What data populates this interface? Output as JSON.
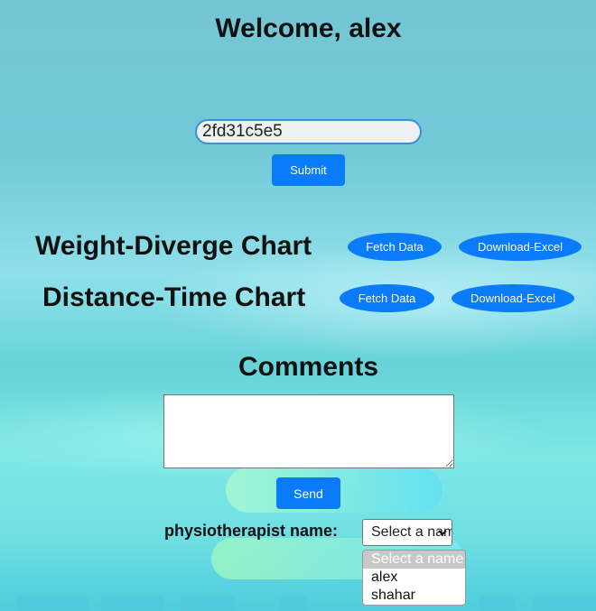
{
  "header": {
    "welcome": "Welcome, alex"
  },
  "code_form": {
    "input_value": "2fd31c5e5",
    "submit_label": "Submit"
  },
  "charts": [
    {
      "title": "Weight-Diverge Chart",
      "fetch_label": "Fetch Data",
      "download_label": "Download-Excel"
    },
    {
      "title": "Distance-Time Chart",
      "fetch_label": "Fetch Data",
      "download_label": "Download-Excel"
    }
  ],
  "comments": {
    "title": "Comments",
    "text": "",
    "send_label": "Send"
  },
  "physiotherapist": {
    "label": "physiotherapist name:",
    "selected": "Select a name",
    "options": [
      "Select a name",
      "alex",
      "shahar"
    ]
  },
  "colors": {
    "button_blue": "#0a7bfa",
    "input_border": "#3b8fd8",
    "title_text": "#111111"
  }
}
